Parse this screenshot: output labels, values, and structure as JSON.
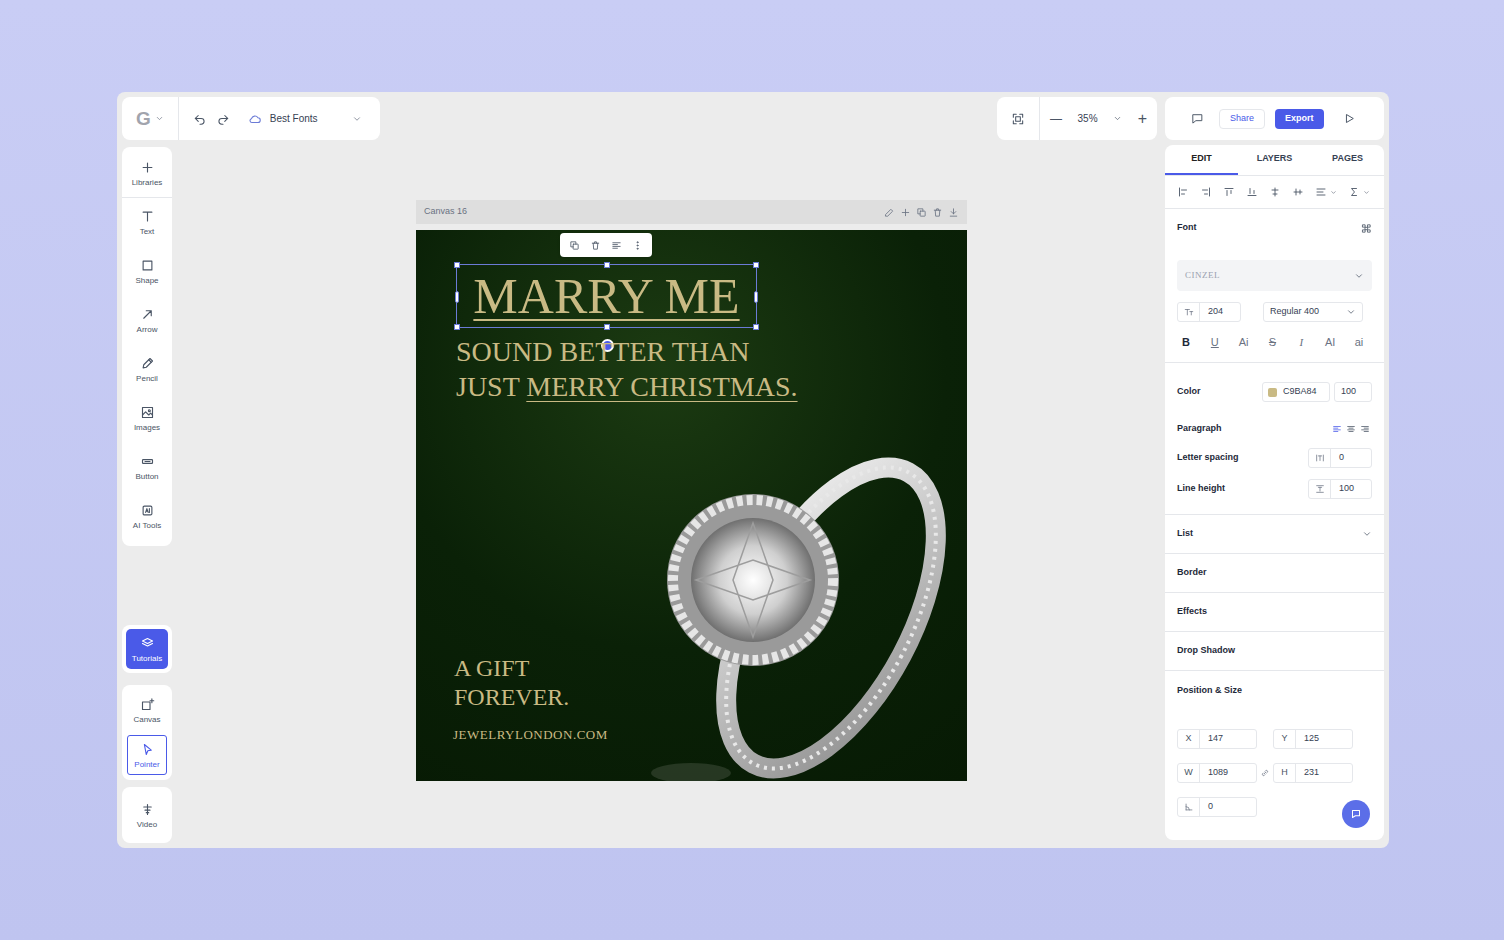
{
  "app": {
    "logo": "G",
    "project": "Best Fonts"
  },
  "zoom": {
    "minus": "—",
    "value": "35%",
    "plus": "+"
  },
  "header_actions": {
    "share": "Share",
    "export": "Export"
  },
  "tools": [
    {
      "label": "Libraries",
      "selected": false
    },
    {
      "label": "Text",
      "selected": false
    },
    {
      "label": "Shape",
      "selected": false
    },
    {
      "label": "Arrow",
      "selected": false
    },
    {
      "label": "Pencil",
      "selected": false
    },
    {
      "label": "Images",
      "selected": false
    },
    {
      "label": "Button",
      "selected": false
    },
    {
      "label": "AI Tools",
      "selected": false
    }
  ],
  "tutorials": {
    "label": "Tutorials"
  },
  "mode_tools": [
    {
      "label": "Canvas",
      "selected": false
    },
    {
      "label": "Pointer",
      "selected": true
    }
  ],
  "video_tool": {
    "label": "Video"
  },
  "canvas": {
    "title": "Canvas 16",
    "headline": {
      "text": "MARRY ME",
      "underline": true,
      "selected": true
    },
    "subhead": [
      [
        {
          "text": "SOUND BETTER THAN",
          "underline": false
        }
      ],
      [
        {
          "text": "JUST ",
          "underline": false
        },
        {
          "text": "MERRY CHRISTMAS.",
          "underline": true
        }
      ]
    ],
    "tagline": [
      "A GIFT",
      "FOREVER."
    ],
    "website": "JEWELRYLONDON.COM"
  },
  "panel": {
    "tabs": [
      {
        "label": "EDIT",
        "selected": true
      },
      {
        "label": "LAYERS",
        "selected": false
      },
      {
        "label": "PAGES",
        "selected": false
      }
    ],
    "font": {
      "label": "Font",
      "family": "CINZEL",
      "size": "204",
      "weight": "Regular 400",
      "styles": [
        {
          "label": "B",
          "kind": "bold"
        },
        {
          "label": "U",
          "kind": "underline"
        },
        {
          "label": "Ai",
          "kind": "plain"
        },
        {
          "label": "S",
          "kind": "strike"
        },
        {
          "label": "I",
          "kind": "italic"
        },
        {
          "label": "AI",
          "kind": "plain"
        },
        {
          "label": "ai",
          "kind": "plain"
        }
      ]
    },
    "color": {
      "label": "Color",
      "hex": "C9BA84",
      "opacity": "100",
      "swatch": "#C9BA84"
    },
    "paragraph": {
      "label": "Paragraph",
      "align": [
        {
          "selected": true
        },
        {
          "selected": false
        },
        {
          "selected": false
        }
      ]
    },
    "letter_spacing": {
      "label": "Letter spacing",
      "value": "0"
    },
    "line_height": {
      "label": "Line height",
      "value": "100"
    },
    "sections": [
      {
        "label": "List",
        "expandable": true
      },
      {
        "label": "Border",
        "expandable": false
      },
      {
        "label": "Effects",
        "expandable": false
      },
      {
        "label": "Drop Shadow",
        "expandable": false
      }
    ],
    "position": {
      "label": "Position & Size",
      "fields": [
        {
          "axis": "X",
          "value": "147"
        },
        {
          "axis": "Y",
          "value": "125"
        },
        {
          "axis": "W",
          "value": "1089"
        },
        {
          "axis": "H",
          "value": "231"
        }
      ],
      "rotation": "0"
    }
  }
}
